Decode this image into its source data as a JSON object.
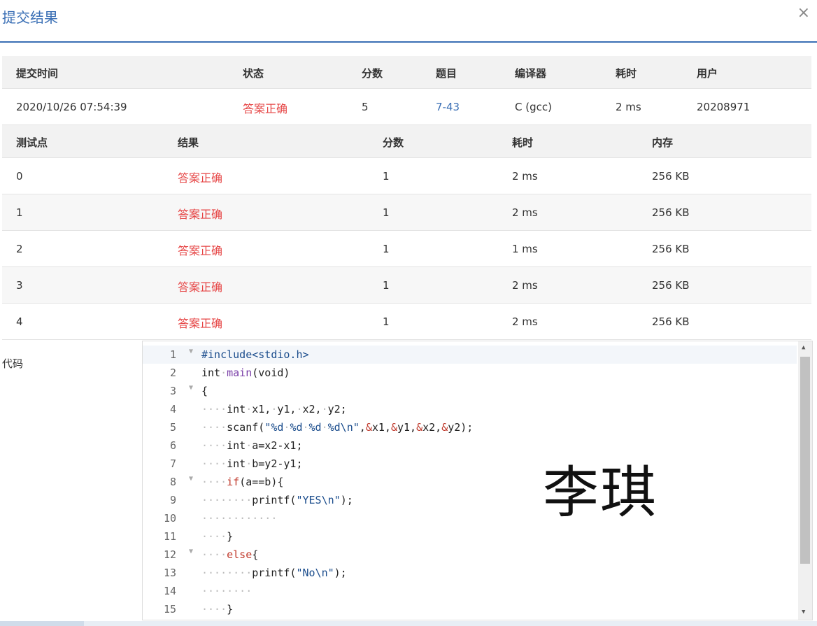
{
  "header": {
    "title": "提交结果",
    "close": "×"
  },
  "submission": {
    "headers": [
      "提交时间",
      "状态",
      "分数",
      "题目",
      "编译器",
      "耗时",
      "用户"
    ],
    "row": {
      "time": "2020/10/26 07:54:39",
      "status": "答案正确",
      "score": "5",
      "problem": "7-43",
      "compiler": "C (gcc)",
      "elapsed": "2 ms",
      "user": "20208971"
    }
  },
  "tests": {
    "headers": [
      "测试点",
      "结果",
      "分数",
      "耗时",
      "内存"
    ],
    "rows": [
      {
        "id": "0",
        "result": "答案正确",
        "score": "1",
        "time": "2 ms",
        "memory": "256 KB"
      },
      {
        "id": "1",
        "result": "答案正确",
        "score": "1",
        "time": "2 ms",
        "memory": "256 KB"
      },
      {
        "id": "2",
        "result": "答案正确",
        "score": "1",
        "time": "1 ms",
        "memory": "256 KB"
      },
      {
        "id": "3",
        "result": "答案正确",
        "score": "1",
        "time": "2 ms",
        "memory": "256 KB"
      },
      {
        "id": "4",
        "result": "答案正确",
        "score": "1",
        "time": "2 ms",
        "memory": "256 KB"
      }
    ]
  },
  "code": {
    "label": "代码",
    "lines": [
      "#include<stdio.h>",
      "int main(void)",
      "{",
      "    int x1, y1, x2, y2;",
      "    scanf(\"%d %d %d %d\\n\",&x1,&y1,&x2,&y2);",
      "    int a=x2-x1;",
      "    int b=y2-y1;",
      "    if(a==b){",
      "        printf(\"YES\\n\");",
      "            ",
      "    }",
      "    else{",
      "        printf(\"No\\n\");",
      "        ",
      "    }"
    ],
    "fold_lines": [
      1,
      3,
      8,
      12
    ]
  },
  "watermark": "李琪",
  "colors": {
    "accent": "#3a6fb5",
    "ok": "#e64545"
  }
}
